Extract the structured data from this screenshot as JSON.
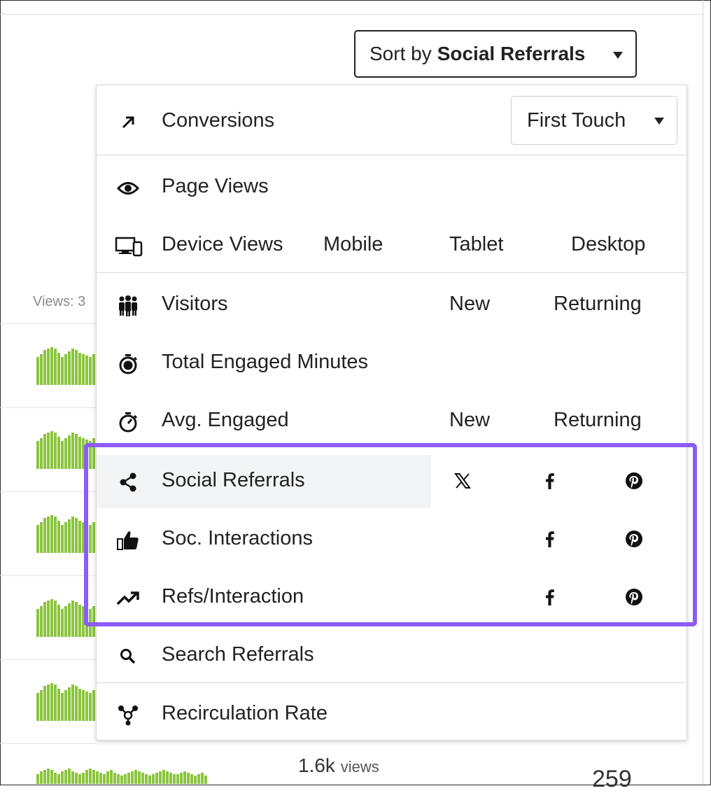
{
  "page": {
    "views_summary": "Views: 3",
    "bottom_views_number": "1.6k",
    "bottom_views_unit": "views",
    "bottom_count": "259"
  },
  "sort": {
    "prefix": "Sort by",
    "value": "Social Referrals"
  },
  "menu": {
    "conversions": {
      "label": "Conversions",
      "icon": "arrow-up-right-icon",
      "attribution": "First Touch"
    },
    "page_views": {
      "label": "Page Views",
      "icon": "eye-icon"
    },
    "device_views": {
      "label": "Device Views",
      "icon": "devices-icon",
      "options": [
        "Mobile",
        "Tablet",
        "Desktop"
      ]
    },
    "visitors": {
      "label": "Visitors",
      "icon": "people-icon",
      "options": [
        "New",
        "Returning"
      ]
    },
    "total_engaged": {
      "label": "Total Engaged Minutes",
      "icon": "stopwatch-icon"
    },
    "avg_engaged": {
      "label": "Avg. Engaged",
      "icon": "timer-icon",
      "options": [
        "New",
        "Returning"
      ]
    },
    "social_referrals": {
      "label": "Social Referrals",
      "icon": "share-icon",
      "networks": [
        "x-icon",
        "facebook-icon",
        "pinterest-icon"
      ],
      "selected": true
    },
    "soc_interactions": {
      "label": "Soc. Interactions",
      "icon": "thumbs-up-icon",
      "networks": [
        "facebook-icon",
        "pinterest-icon"
      ]
    },
    "refs_interaction": {
      "label": "Refs/Interaction",
      "icon": "trending-up-icon",
      "networks": [
        "facebook-icon",
        "pinterest-icon"
      ]
    },
    "search_referrals": {
      "label": "Search Referrals",
      "icon": "search-icon"
    },
    "recirculation": {
      "label": "Recirculation Rate",
      "icon": "network-icon"
    }
  },
  "colors": {
    "highlight": "#8b5cf6",
    "sparkline": "#8bc53f",
    "selected_row_bg": "#f3f4f6"
  }
}
